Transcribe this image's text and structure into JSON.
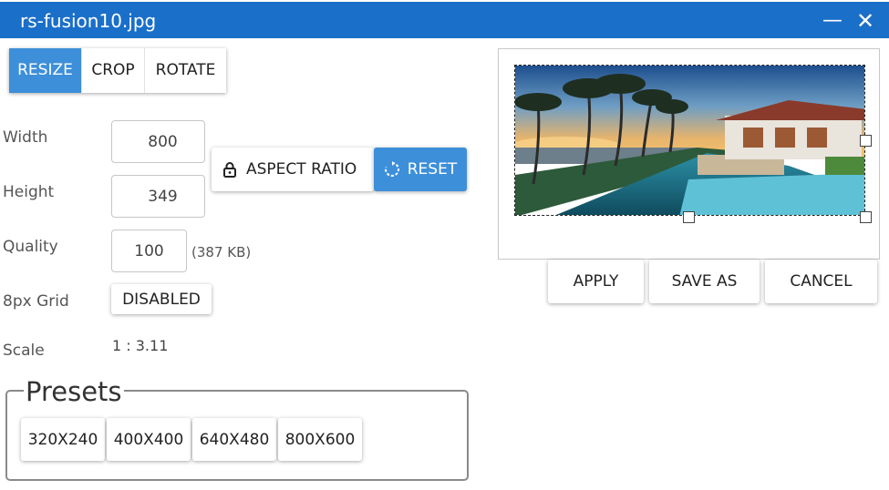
{
  "window": {
    "title": "rs-fusion10.jpg"
  },
  "tabs": [
    {
      "label": "RESIZE",
      "active": true
    },
    {
      "label": "CROP",
      "active": false
    },
    {
      "label": "ROTATE",
      "active": false
    }
  ],
  "fields": {
    "width": {
      "label": "Width",
      "value": "800"
    },
    "height": {
      "label": "Height",
      "value": "349"
    },
    "quality": {
      "label": "Quality",
      "value": "100",
      "size_note": "(387 KB)"
    },
    "grid": {
      "label": "8px Grid",
      "value": "DISABLED"
    },
    "scale": {
      "label": "Scale",
      "value": "1 : 3.11"
    }
  },
  "buttons": {
    "aspect_ratio": "ASPECT RATIO",
    "reset": "RESET",
    "apply": "APPLY",
    "save_as": "SAVE AS",
    "cancel": "CANCEL"
  },
  "presets": {
    "title": "Presets",
    "items": [
      "320X240",
      "400X400",
      "640X480",
      "800X600"
    ]
  },
  "colors": {
    "titlebar": "#1a6fc9",
    "accent": "#3d8fd9"
  },
  "icons": {
    "minimize": "minimize-icon",
    "close": "close-icon",
    "lock": "lock-icon",
    "reset": "reset-icon"
  }
}
